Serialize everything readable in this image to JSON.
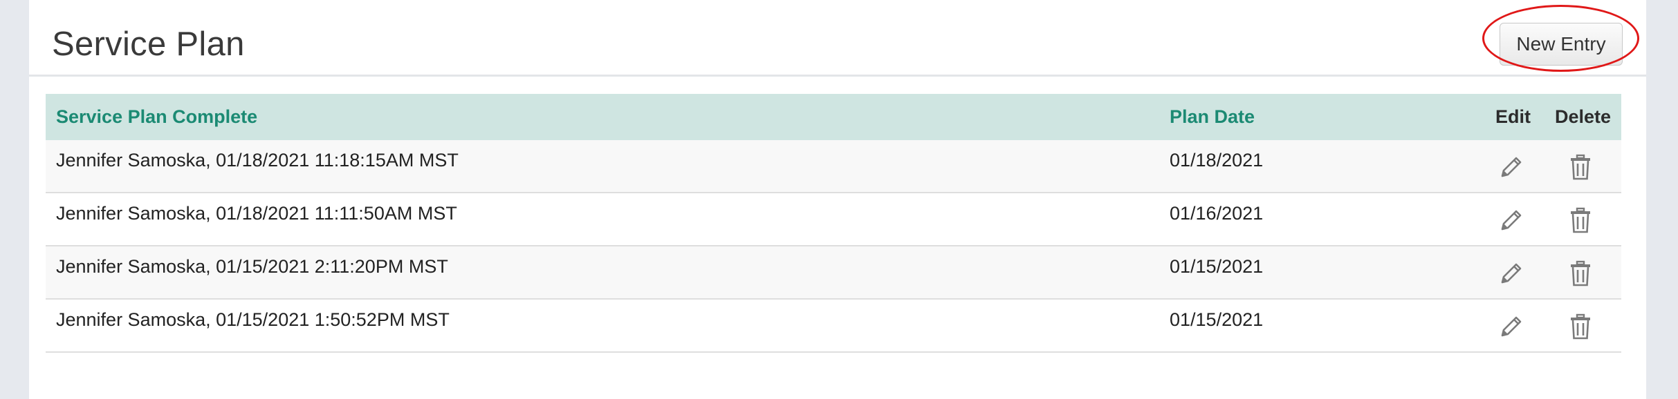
{
  "page": {
    "title": "Service Plan"
  },
  "toolbar": {
    "new_entry_label": "New Entry"
  },
  "table": {
    "headers": {
      "complete": "Service Plan Complete",
      "plan_date": "Plan Date",
      "edit": "Edit",
      "delete": "Delete"
    },
    "rows": [
      {
        "complete": "Jennifer Samoska, 01/18/2021 11:18:15AM MST",
        "plan_date": "01/18/2021"
      },
      {
        "complete": "Jennifer Samoska, 01/18/2021 11:11:50AM MST",
        "plan_date": "01/16/2021"
      },
      {
        "complete": "Jennifer Samoska, 01/15/2021 2:11:20PM MST",
        "plan_date": "01/15/2021"
      },
      {
        "complete": "Jennifer Samoska, 01/15/2021 1:50:52PM MST",
        "plan_date": "01/15/2021"
      }
    ]
  },
  "icons": {
    "edit": "pencil-icon",
    "delete": "trash-icon"
  },
  "colors": {
    "header_bg": "#cfe5e1",
    "header_text": "#1b8a73",
    "highlight": "#e01818"
  }
}
